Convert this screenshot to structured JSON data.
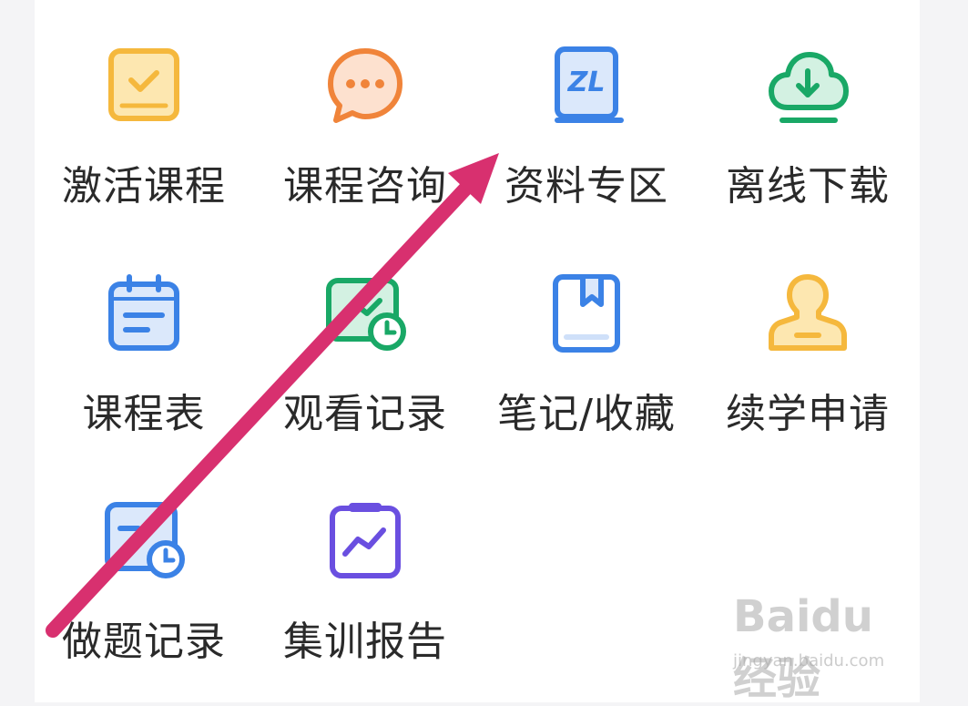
{
  "menu": {
    "items": [
      {
        "label": "激活课程",
        "icon": "activate-course-icon",
        "color": "#f5b83d"
      },
      {
        "label": "课程咨询",
        "icon": "chat-bubble-icon",
        "color": "#f0843a"
      },
      {
        "label": "资料专区",
        "icon": "book-icon",
        "color": "#3b82e6"
      },
      {
        "label": "离线下载",
        "icon": "cloud-download-icon",
        "color": "#19a866"
      },
      {
        "label": "课程表",
        "icon": "calendar-icon",
        "color": "#3b82e6"
      },
      {
        "label": "观看记录",
        "icon": "watch-history-icon",
        "color": "#19a866"
      },
      {
        "label": "笔记/收藏",
        "icon": "bookmark-icon",
        "color": "#3b82e6"
      },
      {
        "label": "续学申请",
        "icon": "user-stamp-icon",
        "color": "#f5b83d"
      },
      {
        "label": "做题记录",
        "icon": "exercise-record-icon",
        "color": "#3b82e6"
      },
      {
        "label": "集训报告",
        "icon": "report-chart-icon",
        "color": "#6a4fe0"
      }
    ]
  },
  "annotation": {
    "arrow_color": "#d8306f"
  },
  "watermark": {
    "brand": "Baidu经验",
    "url": "jingyan.baidu.com"
  }
}
